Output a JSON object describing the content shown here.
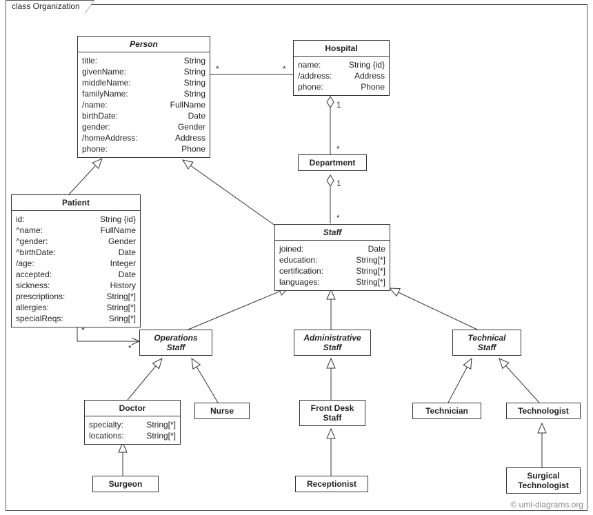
{
  "package_name": "class Organization",
  "watermark": "© uml-diagrams.org",
  "classes": {
    "person": {
      "name": "Person",
      "abstract": true,
      "attrs": [
        {
          "n": "title:",
          "t": "String"
        },
        {
          "n": "givenName:",
          "t": "String"
        },
        {
          "n": "middleName:",
          "t": "String"
        },
        {
          "n": "familyName:",
          "t": "String"
        },
        {
          "n": "/name:",
          "t": "FullName"
        },
        {
          "n": "birthDate:",
          "t": "Date"
        },
        {
          "n": "gender:",
          "t": "Gender"
        },
        {
          "n": "/homeAddress:",
          "t": "Address"
        },
        {
          "n": "phone:",
          "t": "Phone"
        }
      ]
    },
    "hospital": {
      "name": "Hospital",
      "abstract": false,
      "attrs": [
        {
          "n": "name:",
          "t": "String {id}"
        },
        {
          "n": "/address:",
          "t": "Address"
        },
        {
          "n": "phone:",
          "t": "Phone"
        }
      ]
    },
    "department": {
      "name": "Department",
      "abstract": false,
      "attrs": []
    },
    "patient": {
      "name": "Patient",
      "abstract": false,
      "attrs": [
        {
          "n": "id:",
          "t": "String {id}"
        },
        {
          "n": "^name:",
          "t": "FullName"
        },
        {
          "n": "^gender:",
          "t": "Gender"
        },
        {
          "n": "^birthDate:",
          "t": "Date"
        },
        {
          "n": "/age:",
          "t": "Integer"
        },
        {
          "n": "accepted:",
          "t": "Date"
        },
        {
          "n": "sickness:",
          "t": "History"
        },
        {
          "n": "prescriptions:",
          "t": "String[*]"
        },
        {
          "n": "allergies:",
          "t": "String[*]"
        },
        {
          "n": "specialReqs:",
          "t": "Sring[*]"
        }
      ]
    },
    "staff": {
      "name": "Staff",
      "abstract": true,
      "attrs": [
        {
          "n": "joined:",
          "t": "Date"
        },
        {
          "n": "education:",
          "t": "String[*]"
        },
        {
          "n": "certification:",
          "t": "String[*]"
        },
        {
          "n": "languages:",
          "t": "String[*]"
        }
      ]
    },
    "operations_staff": {
      "name": "Operations\nStaff",
      "abstract": true,
      "attrs": []
    },
    "administrative_staff": {
      "name": "Administrative\nStaff",
      "abstract": true,
      "attrs": []
    },
    "technical_staff": {
      "name": "Technical\nStaff",
      "abstract": true,
      "attrs": []
    },
    "doctor": {
      "name": "Doctor",
      "abstract": false,
      "attrs": [
        {
          "n": "specialty:",
          "t": "String[*]"
        },
        {
          "n": "locations:",
          "t": "String[*]"
        }
      ]
    },
    "nurse": {
      "name": "Nurse",
      "abstract": false,
      "attrs": []
    },
    "frontdesk": {
      "name": "Front Desk\nStaff",
      "abstract": false,
      "attrs": []
    },
    "technician": {
      "name": "Technician",
      "abstract": false,
      "attrs": []
    },
    "technologist": {
      "name": "Technologist",
      "abstract": false,
      "attrs": []
    },
    "surgeon": {
      "name": "Surgeon",
      "abstract": false,
      "attrs": []
    },
    "receptionist": {
      "name": "Receptionist",
      "abstract": false,
      "attrs": []
    },
    "surgical_technologist": {
      "name": "Surgical\nTechnologist",
      "abstract": false,
      "attrs": []
    }
  },
  "labels": {
    "one": "1",
    "star": "*"
  }
}
